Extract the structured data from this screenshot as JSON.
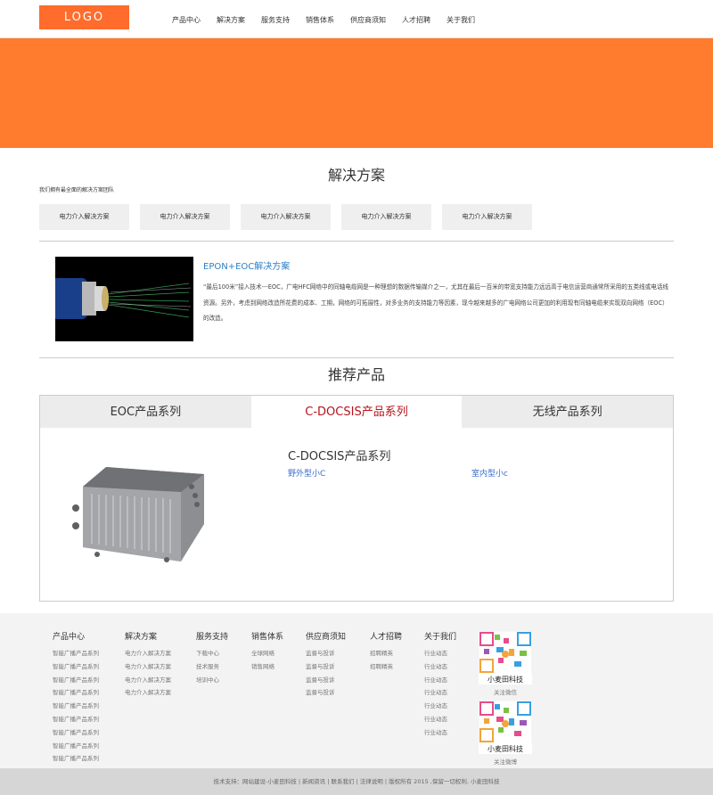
{
  "header": {
    "logo": "LOGO",
    "nav": [
      "产品中心",
      "解决方案",
      "服务支持",
      "销售体系",
      "供应商须知",
      "人才招聘",
      "关于我们"
    ]
  },
  "colors": {
    "accent": "#ff7b2e",
    "link": "#2b80c8",
    "active_tab": "#b5131b"
  },
  "solutions": {
    "title": "解决方案",
    "subtitle": "我们拥有最全面的解决方案团队",
    "tabs": [
      "电力介入解决方案",
      "电力介入解决方案",
      "电力介入解决方案",
      "电力介入解决方案",
      "电力介入解决方案"
    ],
    "case": {
      "title": "EPON+EOC解决方案",
      "text": "“最后100米”接入技术---EOC，广电HFC网络中的同轴电缆网是一种理想的数据传输媒介之一，尤其在最后一百米的带宽支持能力远远高于电信运营商通常所采用的五类线或电话线资源。另外，考虑到网络改造所花费的成本、工期，网络的可拓展性，对多业务的支持能力等因素，现今越来越多的广电网络公司更加的利用现有同轴电缆来实现双向网络（EOC）的改造。"
    }
  },
  "products": {
    "title": "推荐产品",
    "tabs": [
      "EOC产品系列",
      "C-DOCSIS产品系列",
      "无线产品系列"
    ],
    "active_tab": 1,
    "name": "C-DOCSIS产品系列",
    "links": [
      "野外型小C",
      "室内型小c"
    ]
  },
  "footer": {
    "columns": [
      {
        "heading": "产品中心",
        "items": [
          "智能广播产品系列",
          "智能广播产品系列",
          "智能广播产品系列",
          "智能广播产品系列",
          "智能广播产品系列",
          "智能广播产品系列",
          "智能广播产品系列",
          "智能广播产品系列",
          "智能广播产品系列"
        ]
      },
      {
        "heading": "解决方案",
        "items": [
          "电力介入解决方案",
          "电力介入解决方案",
          "电力介入解决方案",
          "电力介入解决方案"
        ]
      },
      {
        "heading": "服务支持",
        "items": [
          "下载中心",
          "技术服务",
          "培训中心"
        ]
      },
      {
        "heading": "销售体系",
        "items": [
          "全球网络",
          "销售网络"
        ]
      },
      {
        "heading": "供应商须知",
        "items": [
          "监督与投诉",
          "监督与投诉",
          "监督与投诉",
          "监督与投诉"
        ]
      },
      {
        "heading": "人才招聘",
        "items": [
          "招聘精英",
          "招聘精英"
        ]
      },
      {
        "heading": "关于我们",
        "items": [
          "行业动态",
          "行业动态",
          "行业动态",
          "行业动态",
          "行业动态",
          "行业动态",
          "行业动态"
        ]
      }
    ],
    "qr": [
      {
        "label": "小麦田科技",
        "caption": "关注微信"
      },
      {
        "label": "小麦田科技",
        "caption": "关注微博"
      }
    ],
    "copyright": "技术支持：网站建设-小麦田科技 | 新闻资讯 | 联系我们 | 法律说明 | 版权所有 2015 ,保留一切权利. 小麦田科技"
  }
}
